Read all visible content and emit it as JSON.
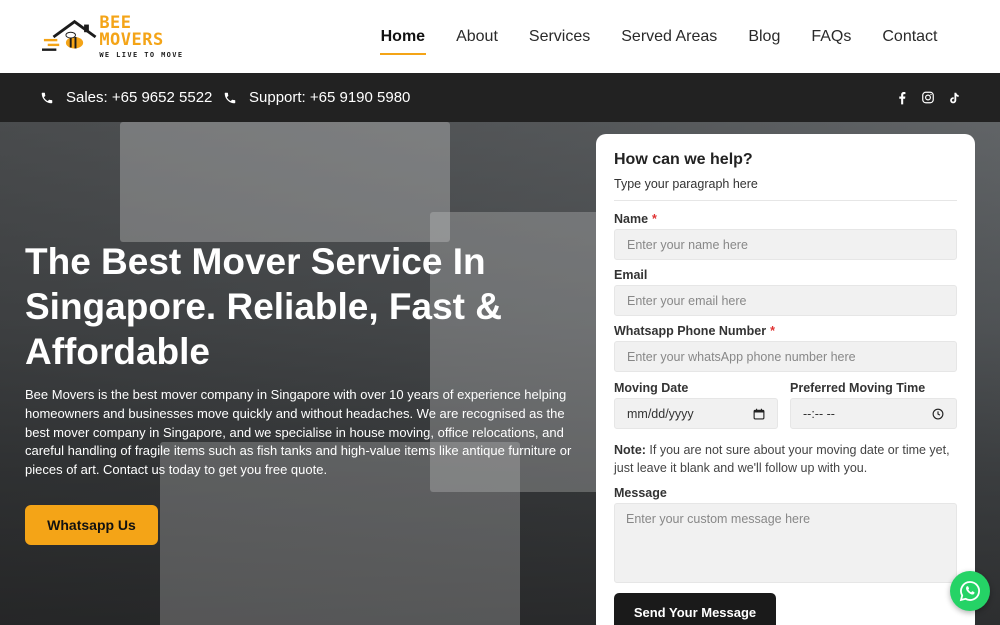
{
  "brand": {
    "name": "BEE MOVERS",
    "tagline": "WE LIVE TO MOVE"
  },
  "nav": {
    "items": [
      {
        "label": "Home",
        "active": true
      },
      {
        "label": "About"
      },
      {
        "label": "Services"
      },
      {
        "label": "Served Areas"
      },
      {
        "label": "Blog"
      },
      {
        "label": "FAQs"
      },
      {
        "label": "Contact"
      }
    ]
  },
  "topbar": {
    "sales": "Sales: +65 9652 5522",
    "support": "Support: +65 9190 5980",
    "social": [
      "facebook-icon",
      "instagram-icon",
      "tiktok-icon"
    ]
  },
  "hero": {
    "title": "The Best Mover Service In Singapore. Reliable, Fast & Affordable",
    "description": "Bee Movers is the best mover company in Singapore with over 10 years of experience helping homeowners and businesses move quickly and without headaches. We are recognised as the best mover company in Singapore, and we specialise in house moving, office relocations, and careful handling of fragile items such as fish tanks and high-value items like antique furniture or pieces of art. Contact us today to get you free quote.",
    "button": "Whatsapp Us"
  },
  "form": {
    "heading": "How can we help?",
    "subheading": "Type your paragraph here",
    "name_label": "Name",
    "name_placeholder": "Enter your name here",
    "email_label": "Email",
    "email_placeholder": "Enter your email here",
    "phone_label": "Whatsapp Phone Number",
    "phone_placeholder": "Enter your whatsApp phone number here",
    "date_label": "Moving Date",
    "date_placeholder": "mm/dd/yyyy",
    "time_label": "Preferred Moving Time",
    "time_placeholder": "--:-- --",
    "note_bold": "Note:",
    "note_text": " If you are not sure about your moving date or time yet, just leave it blank and we'll follow up with you.",
    "message_label": "Message",
    "message_placeholder": "Enter your custom message here",
    "submit": "Send Your Message",
    "required_mark": "*"
  },
  "colors": {
    "accent": "#f4a417",
    "dark": "#222222",
    "whatsapp": "#25d366"
  }
}
